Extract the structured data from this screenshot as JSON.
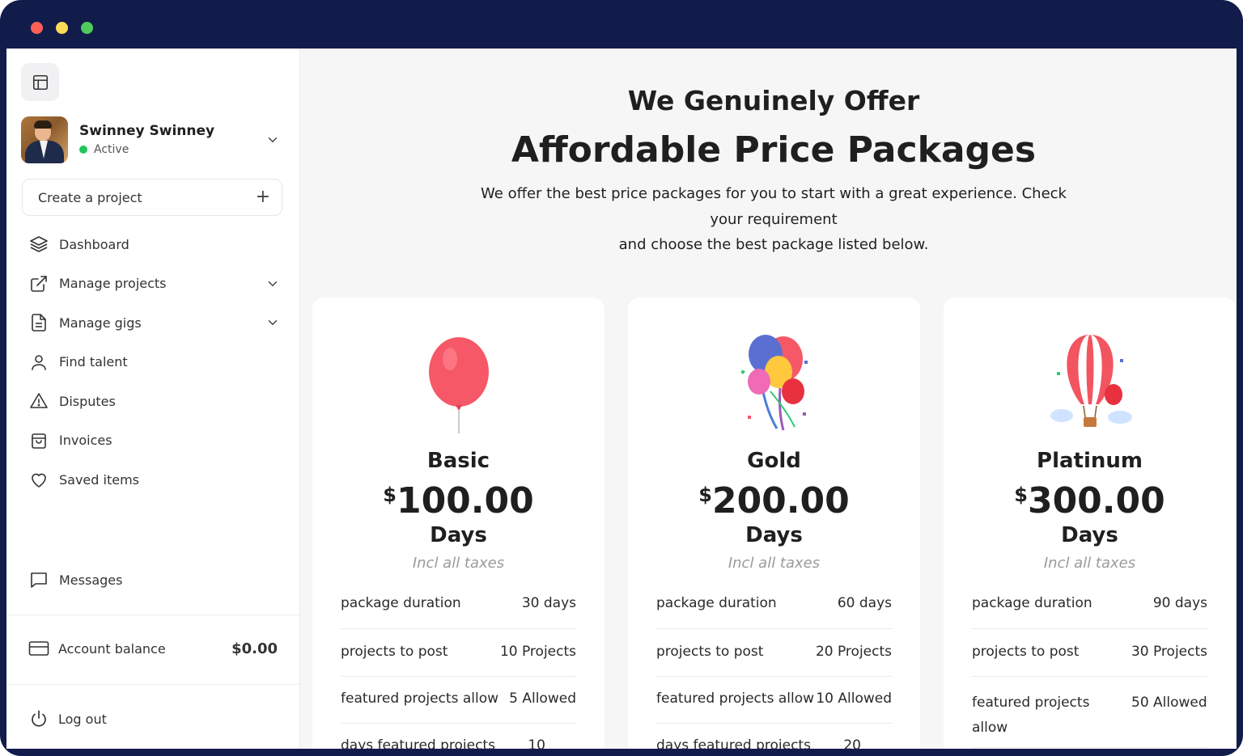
{
  "sidebar": {
    "profile": {
      "name": "Swinney Swinney",
      "status": "Active"
    },
    "create_label": "Create a project",
    "items": [
      {
        "label": "Dashboard",
        "icon": "layers-icon",
        "has_dropdown": false
      },
      {
        "label": "Manage projects",
        "icon": "external-link-icon",
        "has_dropdown": true
      },
      {
        "label": "Manage gigs",
        "icon": "document-icon",
        "has_dropdown": true
      },
      {
        "label": "Find talent",
        "icon": "user-icon",
        "has_dropdown": false
      },
      {
        "label": "Disputes",
        "icon": "warning-icon",
        "has_dropdown": false
      },
      {
        "label": "Invoices",
        "icon": "bag-icon",
        "has_dropdown": false
      },
      {
        "label": "Saved items",
        "icon": "heart-icon",
        "has_dropdown": false
      }
    ],
    "messages_label": "Messages",
    "balance": {
      "label": "Account balance",
      "amount": "$0.00"
    },
    "logout_label": "Log out"
  },
  "main": {
    "subtitle": "We Genuinely Offer",
    "title": "Affordable Price Packages",
    "desc": {
      "line1": "We offer the best price packages for you to start with a great experience. Check",
      "line2": "your requirement",
      "line3": "and choose the best package listed below."
    },
    "cards": [
      {
        "name": "Basic",
        "currency": "$",
        "price": "100.00",
        "period": "Days",
        "tax": "Incl all taxes",
        "features": [
          {
            "label": "package duration",
            "value": "30 days"
          },
          {
            "label": "projects to post",
            "value": "10 Projects"
          },
          {
            "label": "featured projects allow",
            "value": "5 Allowed"
          },
          {
            "label": "days featured projects",
            "value": "10"
          }
        ]
      },
      {
        "name": "Gold",
        "currency": "$",
        "price": "200.00",
        "period": "Days",
        "tax": "Incl all taxes",
        "features": [
          {
            "label": "package duration",
            "value": "60 days"
          },
          {
            "label": "projects to post",
            "value": "20 Projects"
          },
          {
            "label": "featured projects allow",
            "value": "10 Allowed"
          },
          {
            "label": "days featured projects",
            "value": "20"
          }
        ]
      },
      {
        "name": "Platinum",
        "currency": "$",
        "price": "300.00",
        "period": "Days",
        "tax": "Incl all taxes",
        "features": [
          {
            "label": "package duration",
            "value": "90 days"
          },
          {
            "label": "projects to post",
            "value": "30 Projects"
          },
          {
            "label": "featured projects allow",
            "value": "50 Allowed"
          }
        ]
      }
    ]
  },
  "colors": {
    "window_frame": "#121c4a",
    "page_bg": "#f6f6f6",
    "status_active": "#22c55e"
  }
}
